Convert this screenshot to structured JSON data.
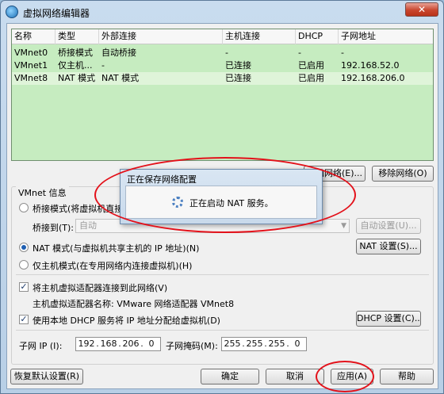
{
  "window": {
    "title": "虚拟网络编辑器",
    "close_glyph": "✕"
  },
  "table": {
    "columns": [
      "名称",
      "类型",
      "外部连接",
      "主机连接",
      "DHCP",
      "子网地址"
    ],
    "rows": [
      {
        "name": "VMnet0",
        "type": "桥接模式",
        "external": "自动桥接",
        "host": "-",
        "dhcp": "-",
        "subnet": "-"
      },
      {
        "name": "VMnet1",
        "type": "仅主机...",
        "external": "-",
        "host": "已连接",
        "dhcp": "已启用",
        "subnet": "192.168.52.0"
      },
      {
        "name": "VMnet8",
        "type": "NAT 模式",
        "external": "NAT 模式",
        "host": "已连接",
        "dhcp": "已启用",
        "subnet": "192.168.206.0"
      }
    ],
    "selected_row": 2
  },
  "buttons": {
    "add_network": "添加网络(E)...",
    "remove_network": "移除网络(O)",
    "auto_settings": "自动设置(U)...",
    "nat_settings": "NAT 设置(S)...",
    "dhcp_settings": "DHCP 设置(C)...",
    "restore_defaults": "恢复默认设置(R)",
    "ok": "确定",
    "cancel": "取消",
    "apply": "应用(A)",
    "help": "帮助"
  },
  "vmnet_info": {
    "group_label": "VMnet 信息",
    "bridged_label": "桥接模式(将虚拟机直接",
    "bridged_to_label": "桥接到(T):",
    "bridged_to_value": "自动",
    "nat_label": "NAT 模式(与虚拟机共享主机的 IP 地址)(N)",
    "hostonly_label": "仅主机模式(在专用网络内连接虚拟机)(H)",
    "connect_adapter_label": "将主机虚拟适配器连接到此网络(V)",
    "adapter_name_label": "主机虚拟适配器名称: VMware 网络适配器 VMnet8",
    "use_dhcp_label": "使用本地 DHCP 服务将 IP 地址分配给虚拟机(D)",
    "selected_mode": "nat",
    "connect_adapter_checked": true,
    "use_dhcp_checked": true
  },
  "subnet": {
    "ip_label": "子网 IP (I):",
    "ip": [
      "192",
      "168",
      "206",
      "0"
    ],
    "mask_label": "子网掩码(M):",
    "mask": [
      "255",
      "255",
      "255",
      "0"
    ]
  },
  "progress_dialog": {
    "title": "正在保存网络配置",
    "message": "正在启动 NAT 服务。"
  },
  "colors": {
    "annotation": "#e3111a",
    "table_bg": "#c6ecc0",
    "selected_row": "#dff4d9"
  }
}
